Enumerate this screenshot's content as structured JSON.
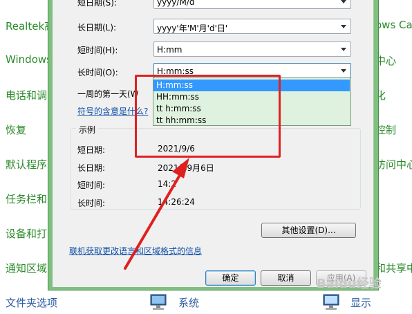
{
  "background": {
    "left_items": [
      "Realtek高",
      "Windows",
      "电话和调",
      "恢复",
      "默认程序",
      "任务栏和",
      "设备和打",
      "通知区域",
      "文件夹选项"
    ],
    "right_items": [
      "ows Ca",
      "中心",
      "化",
      "控制",
      "访问中心",
      "和共享中",
      "显示"
    ],
    "bottom_items": [
      "系统",
      "显示"
    ],
    "icons": [
      "system-computer-icon",
      "display-monitor-icon"
    ]
  },
  "dialog": {
    "rows": [
      {
        "label": "短日期(S):",
        "value": "yyyy/M/d"
      },
      {
        "label": "长日期(L):",
        "value": "yyyy'年'M'月'd'日'"
      },
      {
        "label": "短时间(H):",
        "value": "H:mm"
      },
      {
        "label": "长时间(O):",
        "value": "H:mm:ss"
      }
    ],
    "first_day_label": "一周的第一天(W",
    "symbol_link": "符号的含意是什么?",
    "dropdown_options": [
      "H:mm:ss",
      "HH:mm:ss",
      "tt h:mm:ss",
      "tt hh:mm:ss"
    ],
    "example": {
      "title": "示例",
      "rows": [
        {
          "label": "短日期:",
          "value": "2021/9/6"
        },
        {
          "label": "长日期:",
          "value": "2021年9月6日"
        },
        {
          "label": "短时间:",
          "value": "14:2"
        },
        {
          "label": "长时间:",
          "value": "14:26:24"
        }
      ]
    },
    "other_settings": "其他设置(D)...",
    "online_link": "联机获取更改语言和区域格式的信息",
    "ok": "确定",
    "cancel": "取消",
    "apply": "应用(A)"
  },
  "watermark": "Baidu经验",
  "colors": {
    "annotation_red": "#e02020",
    "highlight": "#3399ff",
    "dialog_frame": "#7fbf7f",
    "cp_green": "#2a8a2a"
  }
}
